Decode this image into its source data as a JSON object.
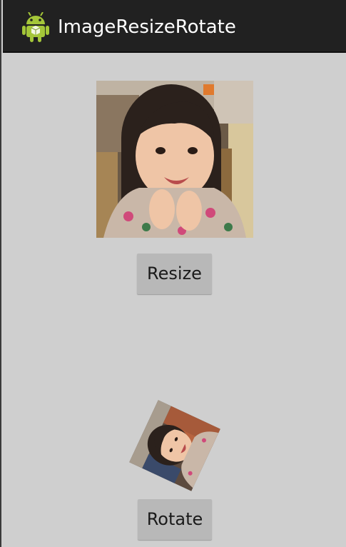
{
  "app": {
    "title": "ImageResizeRotate",
    "icon": "android-robot-icon",
    "accent_color": "#a4c639",
    "actionbar_color": "#212121"
  },
  "main": {
    "resize_button_label": "Resize",
    "rotate_button_label": "Rotate",
    "background_color": "#cfcfcf",
    "rotation_degrees": -65
  }
}
